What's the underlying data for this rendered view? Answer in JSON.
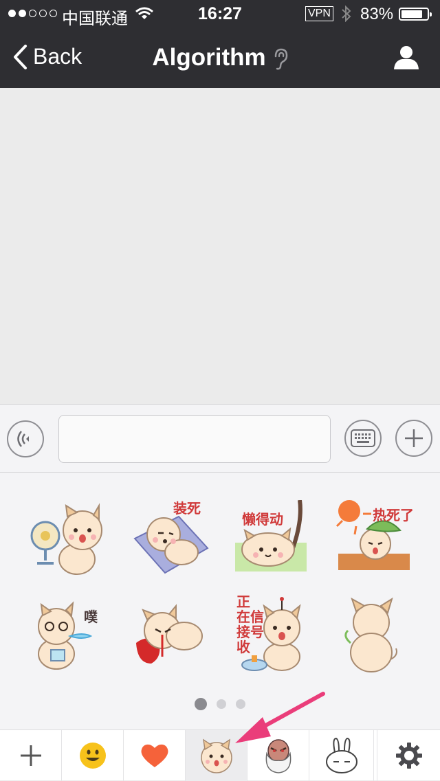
{
  "status_bar": {
    "carrier": "中国联通",
    "time": "16:27",
    "vpn": "VPN",
    "battery_percent": "83%",
    "battery_level": 0.83,
    "signal_bars_on": 2,
    "signal_bars_total": 5
  },
  "nav": {
    "back_label": "Back",
    "title": "Algorithm"
  },
  "input": {
    "value": "",
    "placeholder": ""
  },
  "stickers": [
    {
      "icon": "shiba-fan-sticker"
    },
    {
      "icon": "shiba-play-dead-sticker",
      "text": "装死"
    },
    {
      "icon": "shiba-lazy-sticker",
      "text": "懒得动"
    },
    {
      "icon": "shiba-hot-sticker",
      "text": "热死了"
    },
    {
      "icon": "shiba-spit-sticker",
      "text": "噗"
    },
    {
      "icon": "shiba-bleeding-sticker"
    },
    {
      "icon": "shiba-waiting-signal-sticker",
      "text_lines": [
        "正",
        "在信",
        "接号",
        "收"
      ]
    },
    {
      "icon": "shiba-back-sticker"
    }
  ],
  "pager": {
    "pages": 3,
    "current": 1
  },
  "tabs": [
    {
      "icon": "add-icon"
    },
    {
      "icon": "smiley-icon"
    },
    {
      "icon": "heart-icon"
    },
    {
      "icon": "shiba-pack-icon",
      "selected": true
    },
    {
      "icon": "old-man-pack-icon"
    },
    {
      "icon": "bunny-pack-icon"
    },
    {
      "icon": "settings-gear-icon"
    }
  ],
  "colors": {
    "header_bg": "#2e2e32",
    "chat_bg": "#ebebeb",
    "panel_bg": "#f4f4f6",
    "arrow": "#ea3d7a",
    "heart": "#f5623a",
    "smiley": "#f7c21b",
    "sticker_text": "#d03a3a"
  }
}
